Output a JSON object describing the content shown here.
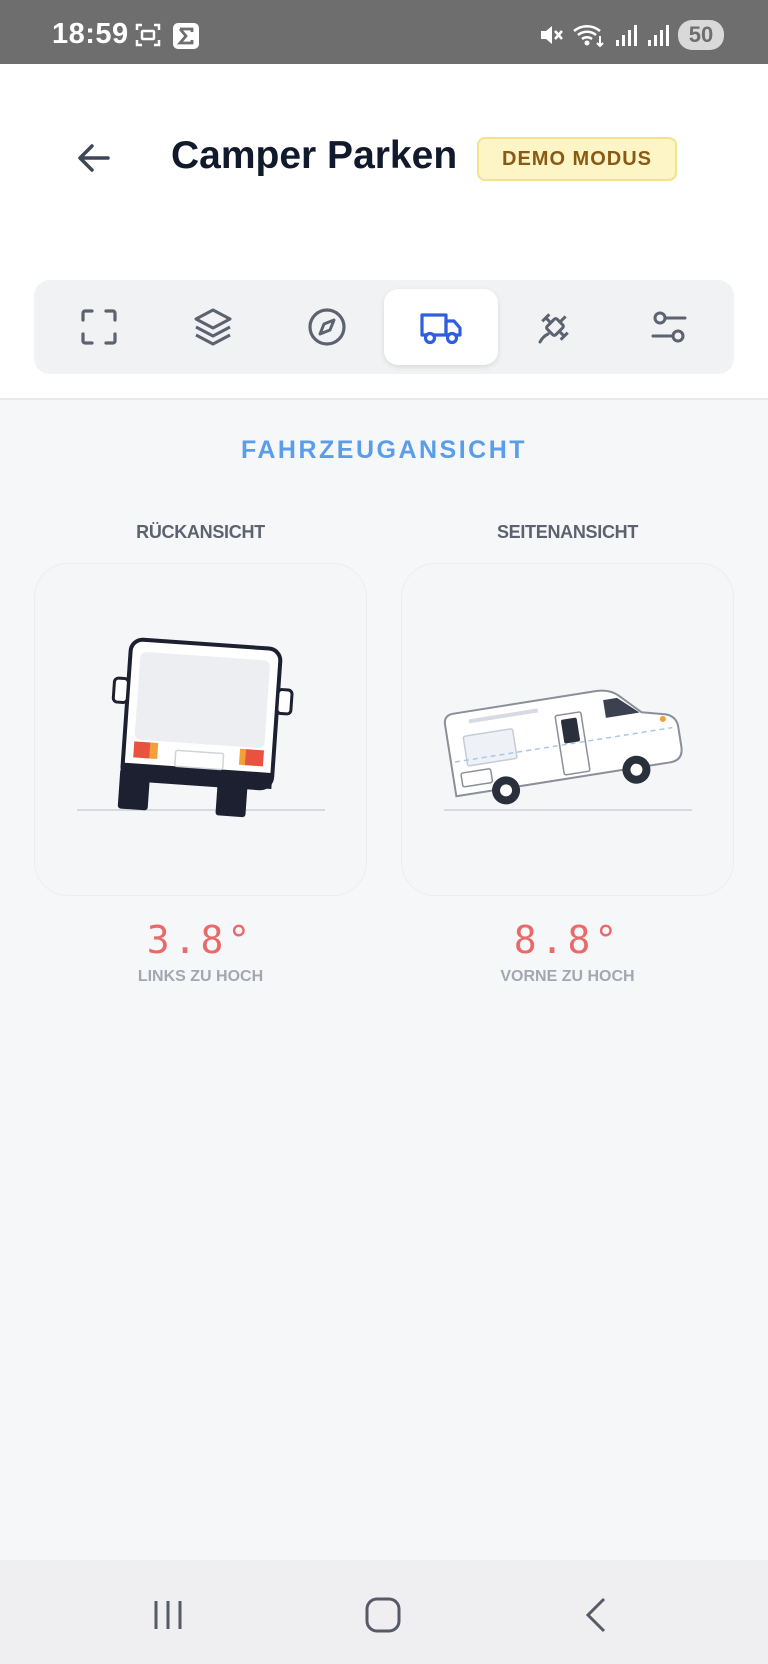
{
  "status_bar": {
    "time": "18:59",
    "battery": "50"
  },
  "header": {
    "title": "Camper Parken",
    "badge": "DEMO MODUS"
  },
  "toolbar": {
    "tools": [
      {
        "icon": "frame-icon"
      },
      {
        "icon": "layers-icon"
      },
      {
        "icon": "compass-icon"
      },
      {
        "icon": "truck-icon",
        "active": true
      },
      {
        "icon": "satellite-icon"
      },
      {
        "icon": "sliders-icon"
      }
    ]
  },
  "main": {
    "section_title": "FAHRZEUGANSICHT",
    "rear": {
      "label": "RÜCKANSICHT",
      "angle": "3.8°",
      "caption": "LINKS ZU HOCH"
    },
    "side": {
      "label": "SEITENANSICHT",
      "angle": "8.8°",
      "caption": "VORNE ZU HOCH"
    }
  },
  "colors": {
    "accent": "#5b9de9",
    "active_tool": "#2f5fe0",
    "angle": "#e86a6a",
    "badge_bg": "#fdf5c6",
    "badge_text": "#8a5a15"
  }
}
